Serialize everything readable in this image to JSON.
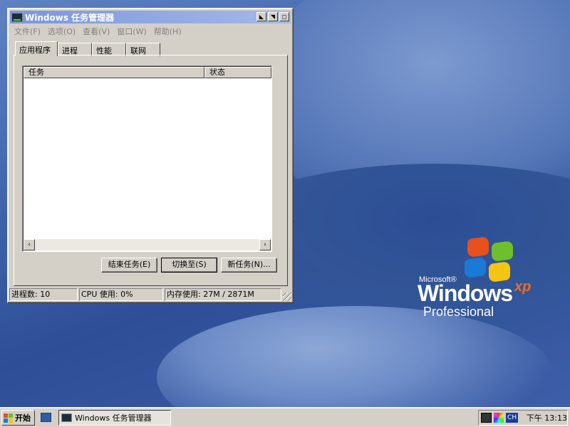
{
  "window": {
    "title": "Windows 任务管理器",
    "controls": [
      "◣",
      "◥",
      "◻"
    ]
  },
  "menubar": [
    "文件(F)",
    "选项(O)",
    "查看(V)",
    "窗口(W)",
    "帮助(H)"
  ],
  "tabs": [
    "应用程序",
    "进程",
    "性能",
    "联网"
  ],
  "active_tab": "应用程序",
  "list": {
    "columns": [
      "任务",
      "状态"
    ],
    "rows": []
  },
  "scrollbar": {
    "left_arrow": "‹",
    "right_arrow": "›"
  },
  "buttons": {
    "end_task": "结束任务(E)",
    "switch_to": "切换至(S)",
    "new_task": "新任务(N)..."
  },
  "status": {
    "processes": "进程数: 10",
    "cpu": "CPU 使用: 0%",
    "memory": "内存使用: 27M / 2871M"
  },
  "desktop": {
    "logo": {
      "microsoft": "Microsoft®",
      "windows": "Windows",
      "xp": "xp",
      "edition": "Professional"
    }
  },
  "taskbar": {
    "start": "开始",
    "task_button": "Windows 任务管理器",
    "tray": {
      "input_lang": "CH",
      "clock": "下午 13:13"
    }
  },
  "colors": {
    "titlebar_start": "#7a96df",
    "titlebar_end": "#a6b9e6",
    "face": "#d4d0c8",
    "desktop": "#3f63aa"
  }
}
